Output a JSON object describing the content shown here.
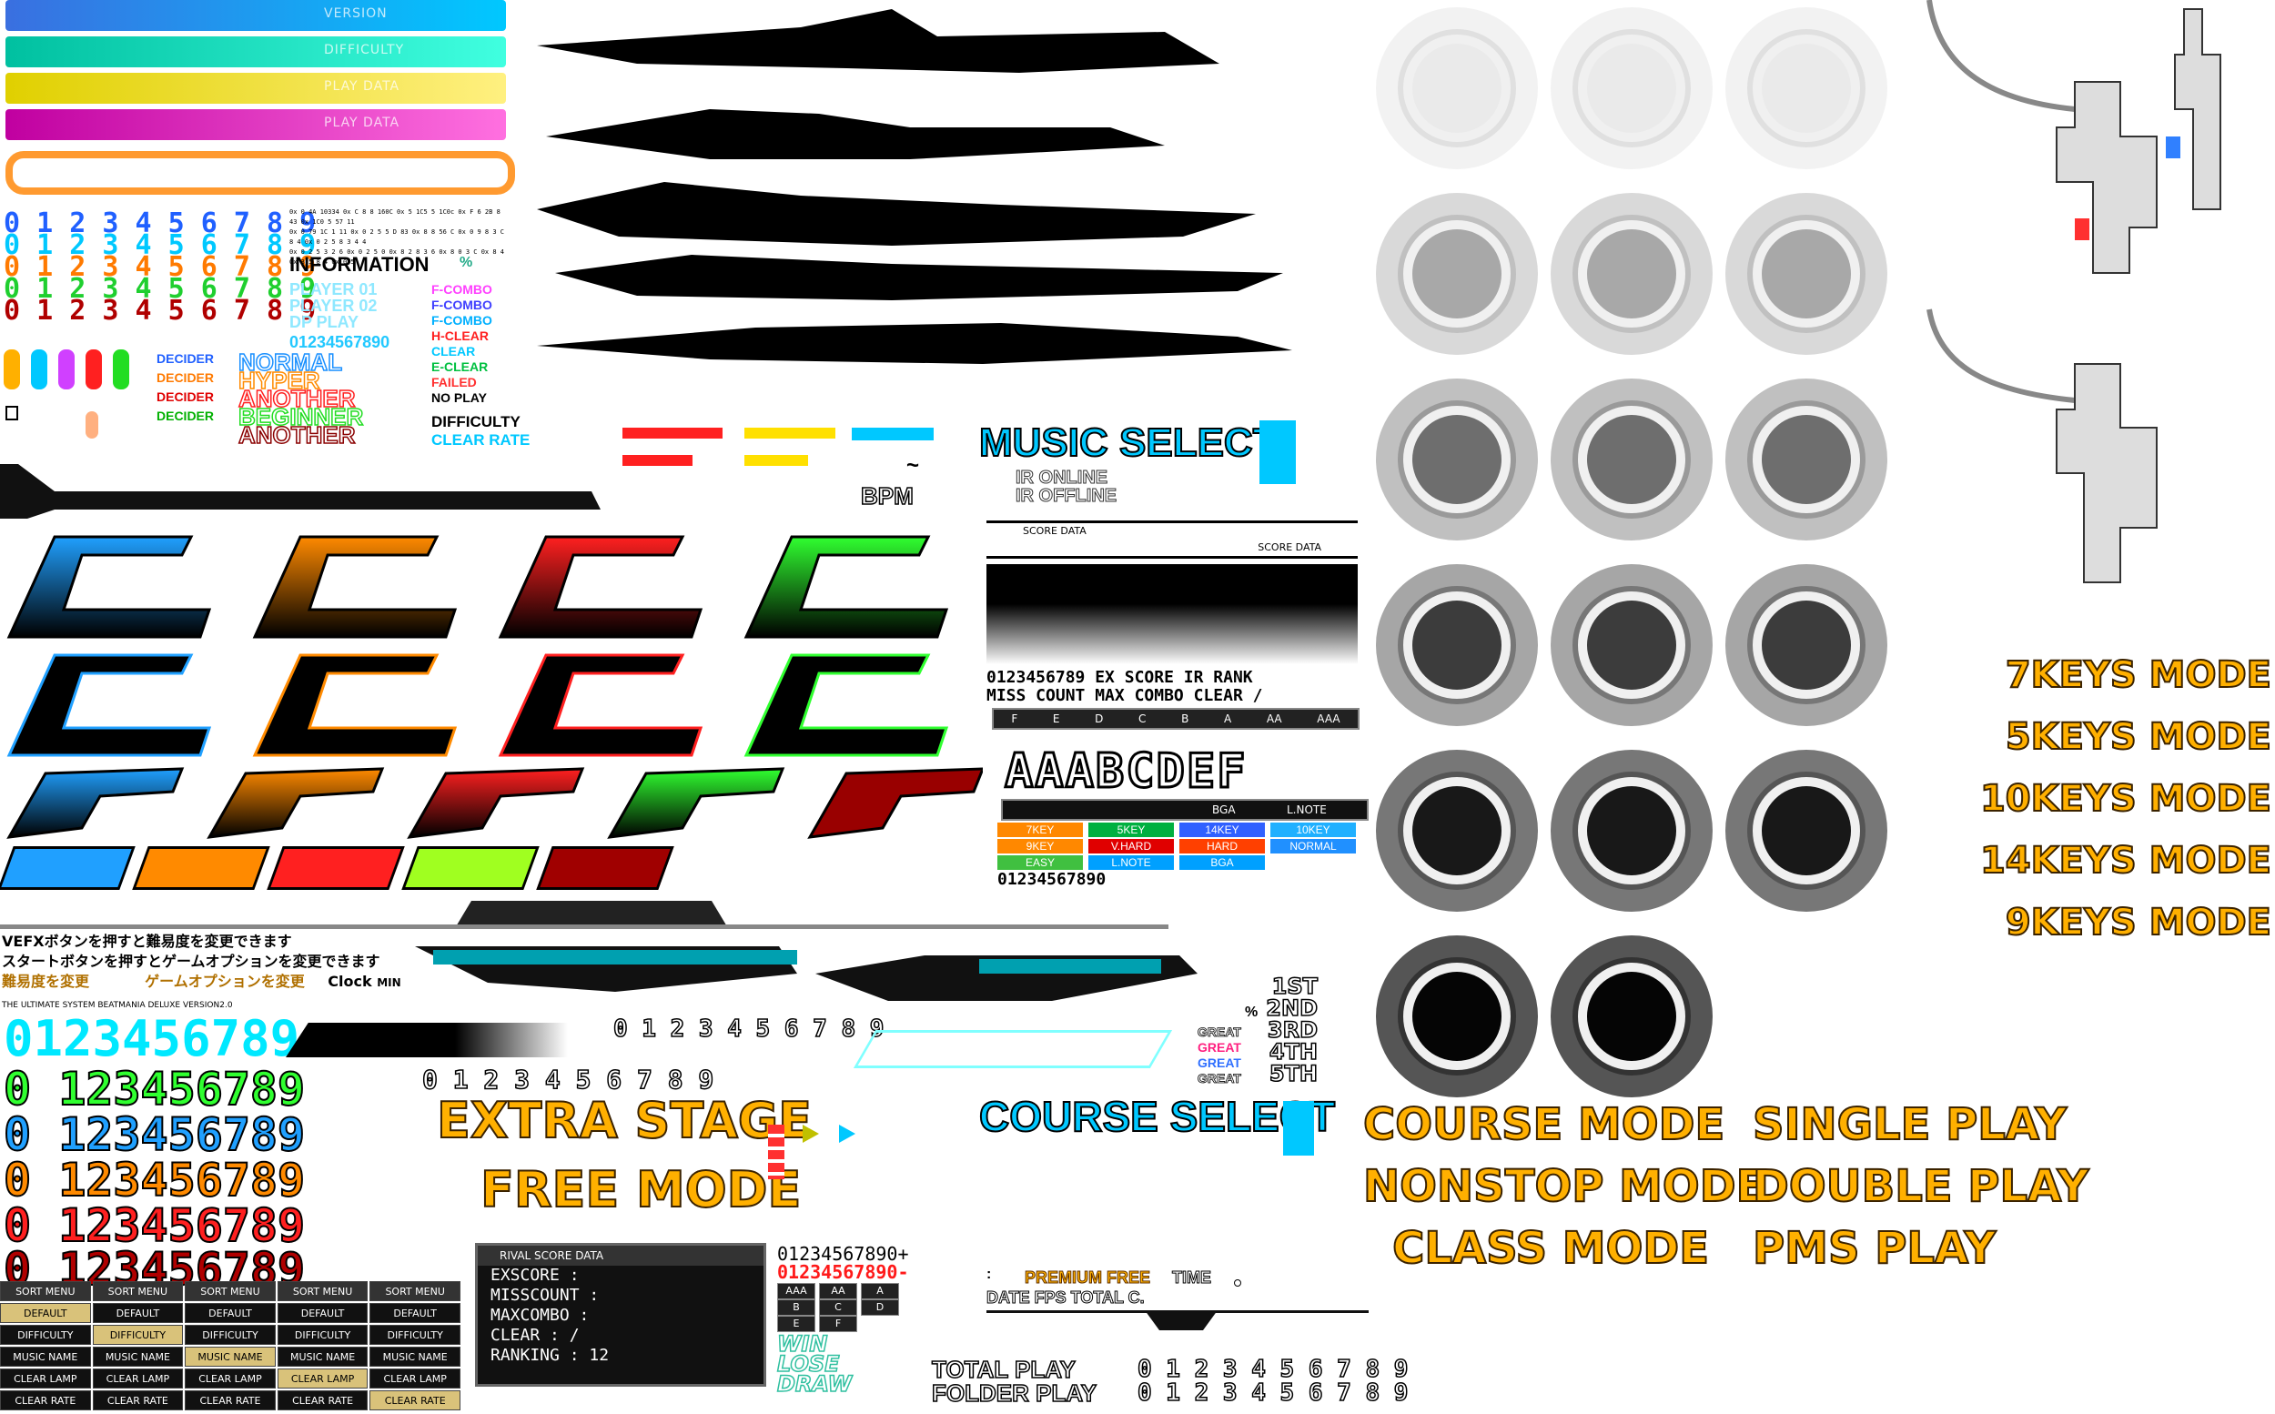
{
  "top_bars": [
    "VERSION",
    "DIFFICULTY",
    "PLAY DATA",
    "PLAY DATA"
  ],
  "digits_row": "0 1 2 3 4 5 6 7 8 9",
  "digits_compact": "0123456789",
  "small_hex_text": [
    "0x 0 4A 10334 0x C 8 8 160C 0x 5 1C5 5 1C0c 0x F 6 2B 8 43 0x 1C0 5 57 11",
    "0x 0 79 1C 1 11 0x 0 2 5 5 D 83 0x 8 8 56 C 0x 0 9 8 3 C 8 4 0x 0 2 5 8 3 4 4",
    "0x 0 2 5 3 2 6 0x 0 2 5 0 0x 8 2 8 3 6 0x 8 0 3 C 0x 8 4 0x 3 5 8 4 0x 0 5"
  ],
  "information": {
    "title": "INFORMATION",
    "percent": "%",
    "players": [
      "PLAYER 01",
      "PLAYER 02",
      "DP PLAY"
    ],
    "numbers": "01234567890"
  },
  "clear_types": [
    "F-COMBO",
    "F-COMBO",
    "F-COMBO",
    "H-CLEAR",
    "CLEAR",
    "E-CLEAR",
    "FAILED",
    "NO PLAY"
  ],
  "decider": [
    "DECIDER",
    "DECIDER",
    "DECIDER",
    "DECIDER"
  ],
  "difficulties": [
    "NORMAL",
    "HYPER",
    "ANOTHER",
    "BEGINNER",
    "ANOTHER"
  ],
  "difficulty_label": "DIFFICULTY",
  "clear_rate_label": "CLEAR RATE",
  "music_select": {
    "title": "MUSIC SELECT",
    "ir_online": "IR ONLINE",
    "ir_offline": "IR OFFLINE",
    "bpm": "BPM",
    "tilde": "~"
  },
  "score_data": {
    "label": "SCORE DATA",
    "digits": "0123456789",
    "labels_line1": [
      "EX SCORE",
      "IR RANK"
    ],
    "labels_line2": [
      "MISS COUNT",
      "MAX COMBO",
      "CLEAR"
    ],
    "slash": "/",
    "ranks": [
      "F",
      "E",
      "D",
      "C",
      "B",
      "A",
      "AA",
      "AAA"
    ],
    "rank_big": "AAABCDEF",
    "bga": "BGA",
    "lnote": "L.NOTE"
  },
  "option_tags": [
    {
      "text": "7KEY",
      "color": "#ff8800"
    },
    {
      "text": "5KEY",
      "color": "#00b040"
    },
    {
      "text": "14KEY",
      "color": "#3060ff"
    },
    {
      "text": "10KEY",
      "color": "#20b0ff"
    },
    {
      "text": "9KEY",
      "color": "#ff8800"
    },
    {
      "text": "V.HARD",
      "color": "#e00000"
    },
    {
      "text": "HARD",
      "color": "#ff4000"
    },
    {
      "text": "NORMAL",
      "color": "#2090ff"
    },
    {
      "text": "EASY",
      "color": "#40c040"
    },
    {
      "text": "L.NOTE",
      "color": "#00a0ff"
    },
    {
      "text": "BGA",
      "color": "#00a0ff"
    }
  ],
  "option_digits": "01234567890",
  "japanese": [
    "VEFXボタンを押すと難易度を変更できます",
    "スタートボタンを押すとゲームオプションを変更できます",
    "難易度を変更",
    "ゲームオプションを変更",
    "Clock",
    "MIN"
  ],
  "subtitle_small": "THE ULTIMATE SYSTEM  BEATMANIA DELUXE  VERSION2.0",
  "big_digits": "0123456789",
  "colored_digit_rows": [
    "0 123456789",
    "0 123456789",
    "0 123456789",
    "0 123456789",
    "0 123456789"
  ],
  "outlined_digits": "0 1 2 3 4 5 6 7 8 9",
  "mid_digits": "0 1 2 3 4 5 6 7 8 9",
  "extra_stage": "EXTRA STAGE",
  "free_mode": "FREE MODE",
  "ranking": {
    "places": [
      "1ST",
      "2ND",
      "3RD",
      "4TH",
      "5TH"
    ],
    "percent": "%",
    "great_labels": [
      "GREAT",
      "GREAT",
      "GREAT",
      "GREAT"
    ]
  },
  "course_select": "COURSE SELECT",
  "sort_menu": {
    "header": "SORT MENU",
    "rows": [
      "DEFAULT",
      "DIFFICULTY",
      "MUSIC NAME",
      "CLEAR LAMP",
      "CLEAR RATE"
    ]
  },
  "rival": {
    "header": "RIVAL SCORE DATA",
    "rows": [
      "EXSCORE    :",
      "MISSCOUNT  :",
      "MAXCOMBO   :",
      "CLEAR      :        /",
      "RANKING    :       12"
    ]
  },
  "rival_digits": [
    "01234567890+",
    "01234567890-"
  ],
  "rival_ranks": [
    "AAA",
    "AA",
    "A",
    "B",
    "C",
    "D",
    "E",
    "F"
  ],
  "result_words": [
    "WIN",
    "LOSE",
    "DRAW"
  ],
  "premium": {
    "label": "PREMIUM FREE",
    "time": "TIME",
    "colon": ":",
    "line2": "DATE FPS TOTAL C."
  },
  "totals": [
    {
      "label": "TOTAL PLAY",
      "digits": "0 1 2 3 4 5 6 7 8 9"
    },
    {
      "label": "FOLDER PLAY",
      "digits": "0 1 2 3 4 5 6 7 8 9"
    }
  ],
  "keys_modes": [
    "7KEYS MODE",
    "5KEYS MODE",
    "10KEYS MODE",
    "14KEYS MODE",
    "9KEYS MODE"
  ],
  "modes_left": [
    "COURSE MODE",
    "NONSTOP MODE",
    "CLASS MODE"
  ],
  "modes_right": [
    "SINGLE PLAY",
    "DOUBLE PLAY",
    "PMS PLAY"
  ],
  "colors": {
    "gold": "#ffb000",
    "cyan": "#00e0ff",
    "magenta": "#ff00cc",
    "red": "#ff1a1a",
    "green": "#22dd22",
    "orange": "#ff8800"
  }
}
